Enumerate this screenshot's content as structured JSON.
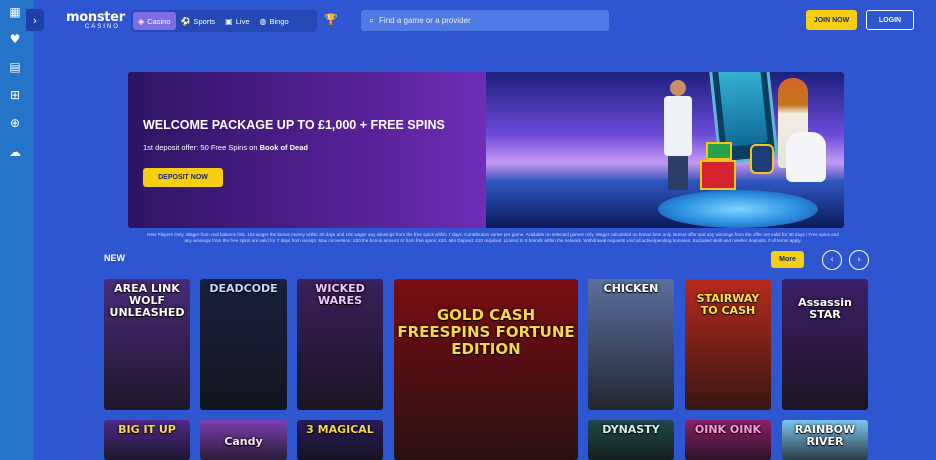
{
  "brand": {
    "name": "monster",
    "sub": "CASINO"
  },
  "products": [
    {
      "label": "Casino",
      "icon": "cube-icon"
    },
    {
      "label": "Sports",
      "icon": "soccer-ball-icon"
    },
    {
      "label": "Live",
      "icon": "cards-icon"
    },
    {
      "label": "Bingo",
      "icon": "bingo-icon"
    }
  ],
  "search": {
    "placeholder": "Find a game or a provider"
  },
  "header": {
    "join_label": "JOIN NOW",
    "login_label": "LOGIN"
  },
  "hero": {
    "title": "WELCOME PACKAGE UP TO £1,000 + FREE SPINS",
    "sub_prefix": "1st deposit offer: 50 Free Spins on ",
    "sub_bold": "Book of Dead",
    "cta": "DEPOSIT NOW"
  },
  "terms": "New Players Only. Wager from real balance first. 10x wager the bonus money within 30 days and 10x wager any winnings from the free spins within 7 days. Contribution varies per game. Available on selected games only. Wager calculated on bonus bets only. Bonus offer and any winnings from the offer are valid for 30 days / Free spins and any winnings from the free spins are valid for 7 days from receipt. Max conversion: £50 the bonus amount or from free spins: £20. Min Deposit: £20 required. Limited to 5 brands within the network. Withdrawal requests void all active/pending bonuses. Excluded skrill and neteller deposits. Full terms apply.",
  "new_section": {
    "title": "NEW",
    "more_label": "More"
  },
  "games": [
    {
      "name": "AREA LINK WOLF UNLEASHED",
      "bg": "#4a2a7a",
      "fg": "#ffffff"
    },
    {
      "name": "DEADCODE",
      "bg": "#18203e",
      "fg": "#c9d6ff"
    },
    {
      "name": "WICKED WARES",
      "bg": "#3a1f5c",
      "fg": "#f4c6ff"
    },
    {
      "name": "GOLD CASH FREESPINS FORTUNE EDITION",
      "bg": "#7a0d12",
      "fg": "#f7d64a"
    },
    {
      "name": "CHICKEN",
      "bg": "#5b6f9e",
      "fg": "#ffffff"
    },
    {
      "name": "STAIRWAY TO CASH",
      "bg": "#b62a1c",
      "fg": "#ffe14a"
    },
    {
      "name": "Assassin STAR",
      "bg": "#3d1f66",
      "fg": "#ffffff"
    },
    {
      "name": "BIG IT UP",
      "bg": "#4c2a8a",
      "fg": "#ffd64a"
    },
    {
      "name": "Candy",
      "bg": "#7a3fb0",
      "fg": "#ffe3f7"
    },
    {
      "name": "3 MAGICAL",
      "bg": "#2a1a5c",
      "fg": "#f7d64a"
    },
    {
      "name": "DYNASTY",
      "bg": "#1f4a4a",
      "fg": "#d8f0ea"
    },
    {
      "name": "OINK OINK",
      "bg": "#8a1f6a",
      "fg": "#ff9ad6"
    },
    {
      "name": "RAINBOW RIVER",
      "bg": "#7dc6f2",
      "fg": "#ffffff"
    }
  ]
}
